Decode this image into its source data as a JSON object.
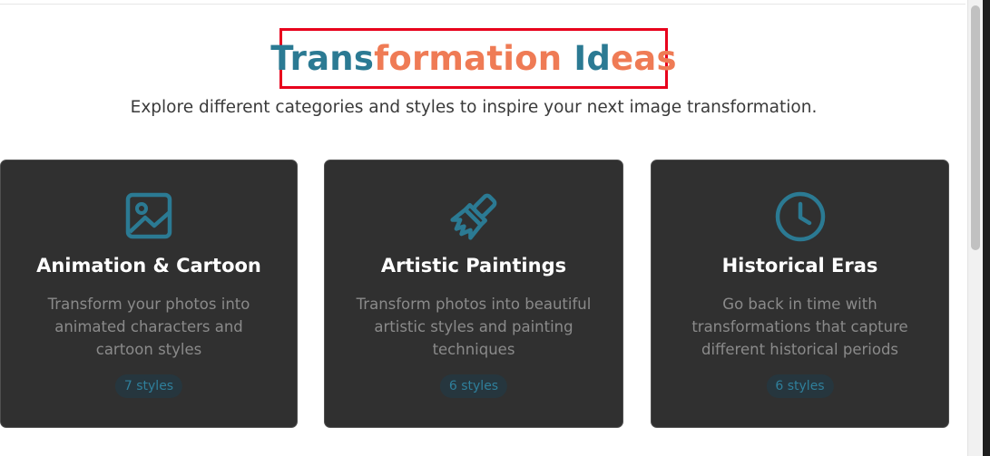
{
  "title": {
    "part1": "Trans",
    "part2": "formation",
    "part3": " Id",
    "part4": "eas"
  },
  "subtitle": "Explore different categories and styles to inspire your next image transformation.",
  "colors": {
    "title_blue": "#2b7a93",
    "title_orange": "#ef7b55",
    "card_bg": "#303030",
    "icon": "#2b7a93",
    "highlight_box": "#e8001c"
  },
  "cards": [
    {
      "icon": "image-icon",
      "title": "Animation & Cartoon",
      "description": "Transform your photos into animated characters and cartoon styles",
      "badge": "7 styles"
    },
    {
      "icon": "paintbrush-icon",
      "title": "Artistic Paintings",
      "description": "Transform photos into beautiful artistic styles and painting techniques",
      "badge": "6 styles"
    },
    {
      "icon": "clock-icon",
      "title": "Historical Eras",
      "description": "Go back in time with transformations that capture different historical periods",
      "badge": "6 styles"
    }
  ]
}
